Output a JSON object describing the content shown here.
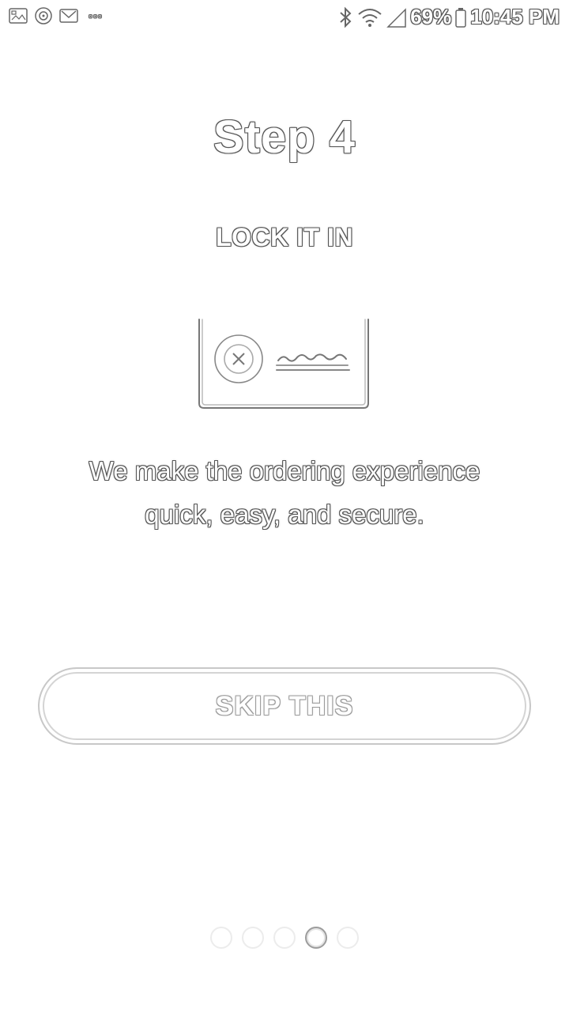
{
  "status_bar": {
    "battery": "69%",
    "time": "10:45 PM",
    "overflow": "◦◦◦",
    "left_icons": [
      "image-notification-icon",
      "target-notification-icon",
      "gmail-notification-icon"
    ],
    "right_icons": [
      "bluetooth-icon",
      "wifi-icon",
      "signal-icon",
      "battery-icon"
    ]
  },
  "onboarding": {
    "title": "Step 4",
    "subtitle": "LOCK IT IN",
    "illustration_icon": "secure-payment-card-icon",
    "description": "We make the ordering experience quick, easy, and secure.",
    "skip_label": "SKIP THIS",
    "page_count": 5,
    "current_page": 4
  },
  "colors": {
    "background": "#ffffff",
    "text_fill": "#ffffff",
    "text_outline": "#555555",
    "button_border": "#c8c8c8",
    "active_dot_border": "#9c9c9c"
  }
}
